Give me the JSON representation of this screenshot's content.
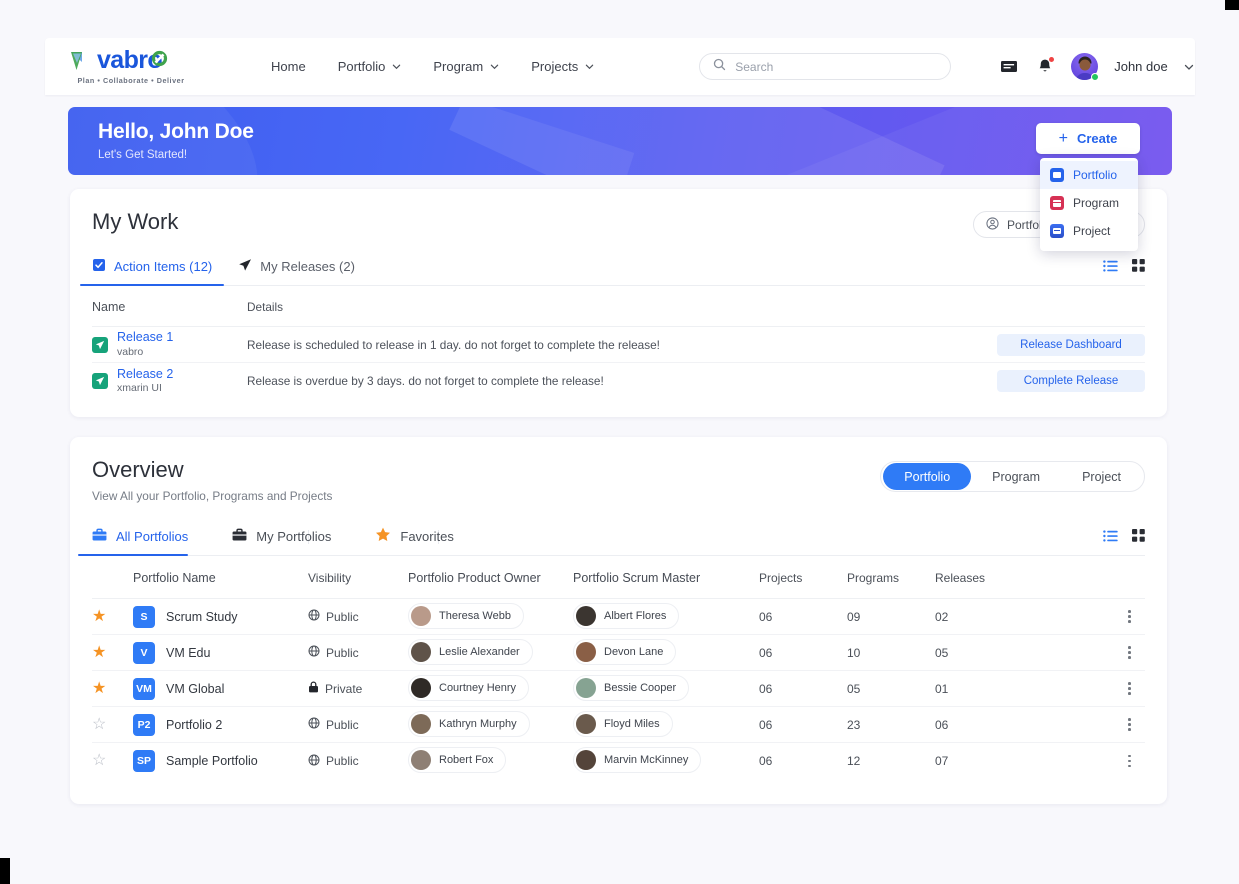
{
  "header": {
    "logo": {
      "name": "vabro",
      "tagline": "Plan • Collaborate • Deliver"
    },
    "nav": [
      {
        "label": "Home",
        "has_chevron": false,
        "icon": ""
      },
      {
        "label": "Portfolio",
        "has_chevron": true,
        "icon": "chevron-down-icon"
      },
      {
        "label": "Program",
        "has_chevron": true,
        "icon": "chevron-down-icon"
      },
      {
        "label": "Projects",
        "has_chevron": true,
        "icon": "chevron-down-icon"
      }
    ],
    "search": {
      "placeholder": "Search",
      "value": "",
      "icon": "search-icon"
    },
    "icons": {
      "reports": "reports-icon",
      "notifications": "bell-icon"
    },
    "user": {
      "name": "John doe",
      "avatar": "avatar",
      "status": "online",
      "chevron": "chevron-down-icon"
    }
  },
  "hero": {
    "title": "Hello, John Doe",
    "subtitle": "Let's Get Started!",
    "gradient_from": "#2f52ef",
    "gradient_to": "#7354ef"
  },
  "create": {
    "label": "Create",
    "plus_icon": "plus-icon",
    "menu": [
      {
        "label": "Portfolio",
        "icon": "portfolio-icon",
        "color": "#2563eb",
        "active": true
      },
      {
        "label": "Program",
        "icon": "program-icon",
        "color": "#d63154",
        "active": false
      },
      {
        "label": "Project",
        "icon": "project-icon",
        "color": "#2b4fc8",
        "active": false
      }
    ]
  },
  "my_work": {
    "title": "My Work",
    "filter": {
      "label": "Portfolio",
      "icon": "user-circle-icon",
      "chevron": "chevron-down-icon"
    },
    "tabs": [
      {
        "label": "Action Items (12)",
        "icon": "checklist-icon",
        "active": true
      },
      {
        "label": "My Releases (2)",
        "icon": "send-icon",
        "active": false
      }
    ],
    "view_toggle": {
      "list": "list-view-icon",
      "grid": "grid-view-icon",
      "active": "list"
    },
    "columns": [
      "Name",
      "Details"
    ],
    "rows": [
      {
        "icon": "release-icon",
        "name": "Release 1",
        "sub": "vabro",
        "details": "Release is scheduled to release in 1 day. do not forget to complete the release!",
        "action": "Release Dashboard"
      },
      {
        "icon": "release-icon",
        "name": "Release 2",
        "sub": "xmarin UI",
        "details": "Release is overdue by 3 days. do not forget to complete the release!",
        "action": "Complete Release"
      }
    ]
  },
  "overview": {
    "title": "Overview",
    "subtitle": "View All your Portfolio, Programs and Projects",
    "segments": [
      {
        "label": "Portfolio",
        "active": true
      },
      {
        "label": "Program",
        "active": false
      },
      {
        "label": "Project",
        "active": false
      }
    ],
    "tabs": [
      {
        "label": "All Portfolios",
        "icon": "briefcase-icon",
        "active": true
      },
      {
        "label": "My Portfolios",
        "icon": "briefcase-icon",
        "active": false
      },
      {
        "label": "Favorites",
        "icon": "star-icon",
        "active": false
      }
    ],
    "view_toggle": {
      "list": "list-view-icon",
      "grid": "grid-view-icon",
      "active": "list"
    },
    "columns": [
      "Portfolio Name",
      "Visibility",
      "Portfolio Product Owner",
      "Portfolio Scrum Master",
      "Projects",
      "Programs",
      "Releases"
    ],
    "rows": [
      {
        "favorite": true,
        "badge": "S",
        "name": "Scrum Study",
        "visibility": "Public",
        "visibility_icon": "globe-icon",
        "owner": "Theresa Webb",
        "scrum_master": "Albert Flores",
        "projects": "06",
        "programs": "09",
        "releases": "02",
        "owner_avatar": "#b99a8a",
        "scrum_avatar": "#3b3530",
        "menu": "kebab-icon"
      },
      {
        "favorite": true,
        "badge": "V",
        "name": "VM Edu",
        "visibility": "Public",
        "visibility_icon": "globe-icon",
        "owner": "Leslie Alexander",
        "scrum_master": "Devon Lane",
        "projects": "06",
        "programs": "10",
        "releases": "05",
        "owner_avatar": "#5f5349",
        "scrum_avatar": "#8a5f46",
        "menu": "kebab-icon"
      },
      {
        "favorite": true,
        "badge": "VM",
        "name": "VM Global",
        "visibility": "Private",
        "visibility_icon": "lock-icon",
        "owner": "Courtney Henry",
        "scrum_master": "Bessie Cooper",
        "projects": "06",
        "programs": "05",
        "releases": "01",
        "owner_avatar": "#2f2a26",
        "scrum_avatar": "#86a392",
        "menu": "kebab-icon"
      },
      {
        "favorite": false,
        "badge": "P2",
        "name": "Portfolio 2",
        "visibility": "Public",
        "visibility_icon": "globe-icon",
        "owner": "Kathryn Murphy",
        "scrum_master": "Floyd Miles",
        "projects": "06",
        "programs": "23",
        "releases": "06",
        "owner_avatar": "#7d6a58",
        "scrum_avatar": "#6a5a4c",
        "menu": "kebab-icon"
      },
      {
        "favorite": false,
        "badge": "SP",
        "name": "Sample Portfolio",
        "visibility": "Public",
        "visibility_icon": "globe-icon",
        "owner": "Robert Fox",
        "scrum_master": "Marvin McKinney",
        "projects": "06",
        "programs": "12",
        "releases": "07",
        "owner_avatar": "#8e7f74",
        "scrum_avatar": "#54443a",
        "menu": "kebab-icon"
      }
    ]
  },
  "colors": {
    "accent": "#2563eb",
    "segment_active": "#2f7bf6",
    "star": "#f59324",
    "green": "#16a37a",
    "red": "#d63154"
  }
}
